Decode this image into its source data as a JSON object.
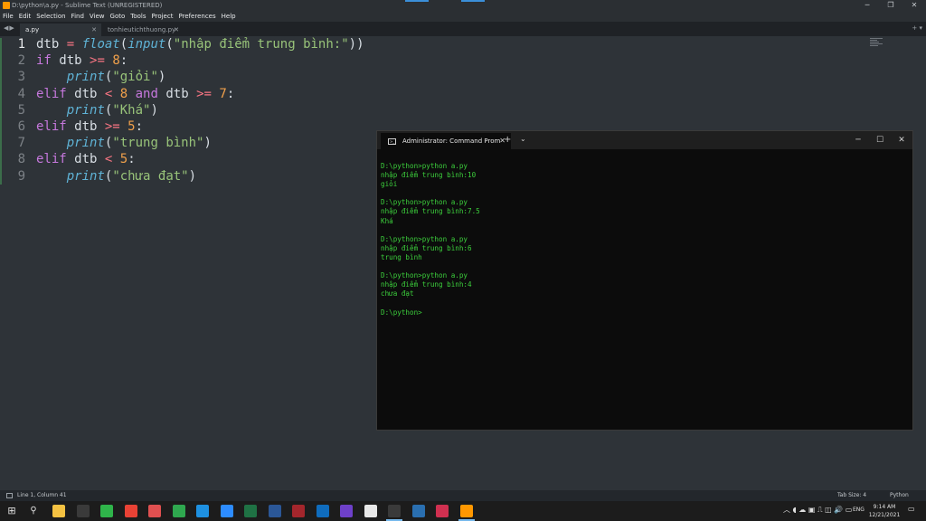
{
  "window": {
    "title": "D:\\python\\a.py - Sublime Text (UNREGISTERED)"
  },
  "menu": [
    "File",
    "Edit",
    "Selection",
    "Find",
    "View",
    "Goto",
    "Tools",
    "Project",
    "Preferences",
    "Help"
  ],
  "tabs": [
    {
      "label": "a.py",
      "active": true
    },
    {
      "label": "tonhieutichthuong.py",
      "active": false
    }
  ],
  "editor": {
    "line_numbers": [
      "1",
      "2",
      "3",
      "4",
      "5",
      "6",
      "7",
      "8",
      "9"
    ],
    "lines": [
      [
        [
          "id",
          "dtb "
        ],
        [
          "op",
          "="
        ],
        [
          "id",
          " "
        ],
        [
          "fn",
          "float"
        ],
        [
          "id",
          "("
        ],
        [
          "fn",
          "input"
        ],
        [
          "id",
          "("
        ],
        [
          "str",
          "\"nhập điểm trung bình:\""
        ],
        [
          "id",
          "))"
        ]
      ],
      [
        [
          "kw",
          "if"
        ],
        [
          "id",
          " dtb "
        ],
        [
          "op",
          ">="
        ],
        [
          "id",
          " "
        ],
        [
          "num",
          "8"
        ],
        [
          "id",
          ":"
        ]
      ],
      [
        [
          "id",
          "    "
        ],
        [
          "fn",
          "print"
        ],
        [
          "id",
          "("
        ],
        [
          "str",
          "\"giỏi\""
        ],
        [
          "id",
          ")"
        ]
      ],
      [
        [
          "kw",
          "elif"
        ],
        [
          "id",
          " dtb "
        ],
        [
          "op",
          "<"
        ],
        [
          "id",
          " "
        ],
        [
          "num",
          "8"
        ],
        [
          "id",
          " "
        ],
        [
          "kw",
          "and"
        ],
        [
          "id",
          " dtb "
        ],
        [
          "op",
          ">="
        ],
        [
          "id",
          " "
        ],
        [
          "num",
          "7"
        ],
        [
          "id",
          ":"
        ]
      ],
      [
        [
          "id",
          "    "
        ],
        [
          "fn",
          "print"
        ],
        [
          "id",
          "("
        ],
        [
          "str",
          "\"Khá\""
        ],
        [
          "id",
          ")"
        ]
      ],
      [
        [
          "kw",
          "elif"
        ],
        [
          "id",
          " dtb "
        ],
        [
          "op",
          ">="
        ],
        [
          "id",
          " "
        ],
        [
          "num",
          "5"
        ],
        [
          "id",
          ":"
        ]
      ],
      [
        [
          "id",
          "    "
        ],
        [
          "fn",
          "print"
        ],
        [
          "id",
          "("
        ],
        [
          "str",
          "\"trung bình\""
        ],
        [
          "id",
          ")"
        ]
      ],
      [
        [
          "kw",
          "elif"
        ],
        [
          "id",
          " dtb "
        ],
        [
          "op",
          "<"
        ],
        [
          "id",
          " "
        ],
        [
          "num",
          "5"
        ],
        [
          "id",
          ":"
        ]
      ],
      [
        [
          "id",
          "    "
        ],
        [
          "fn",
          "print"
        ],
        [
          "id",
          "("
        ],
        [
          "str",
          "\"chưa đạt\""
        ],
        [
          "id",
          ")"
        ]
      ]
    ]
  },
  "status": {
    "position": "Line 1, Column 41",
    "tab_size": "Tab Size: 4",
    "syntax": "Python"
  },
  "cmd": {
    "tab_title": "Administrator: Command Prom",
    "output": [
      "D:\\python>python a.py",
      "nhập điểm trung bình:10",
      "giỏi",
      "",
      "D:\\python>python a.py",
      "nhập điểm trung bình:7.5",
      "Khá",
      "",
      "D:\\python>python a.py",
      "nhập điểm trung bình:6",
      "trung bình",
      "",
      "D:\\python>python a.py",
      "nhập điểm trung bình:4",
      "chưa đạt",
      "",
      "D:\\python>"
    ]
  },
  "taskbar": {
    "apps": [
      {
        "name": "file-explorer",
        "color": "#f5c242"
      },
      {
        "name": "obs",
        "color": "#3a3a3a"
      },
      {
        "name": "camtasia",
        "color": "#2fb44a"
      },
      {
        "name": "chrome",
        "color": "#e94235"
      },
      {
        "name": "app-grid",
        "color": "#e05050"
      },
      {
        "name": "gchat",
        "color": "#2fa84f"
      },
      {
        "name": "skype",
        "color": "#1e90e0"
      },
      {
        "name": "zoom",
        "color": "#2d8cff"
      },
      {
        "name": "excel",
        "color": "#1f7244"
      },
      {
        "name": "word",
        "color": "#2b5797"
      },
      {
        "name": "access",
        "color": "#a4262c"
      },
      {
        "name": "outlook",
        "color": "#0f6cbd"
      },
      {
        "name": "github",
        "color": "#6e40c9"
      },
      {
        "name": "notion",
        "color": "#e8e8e8"
      },
      {
        "name": "cmd",
        "color": "#3a3a3a"
      },
      {
        "name": "photos",
        "color": "#2a6fb0"
      },
      {
        "name": "pycharm",
        "color": "#d03050"
      },
      {
        "name": "sublime",
        "color": "#ff9800"
      }
    ],
    "lang": "ENG",
    "time": "9:14 AM",
    "date": "12/21/2021"
  }
}
